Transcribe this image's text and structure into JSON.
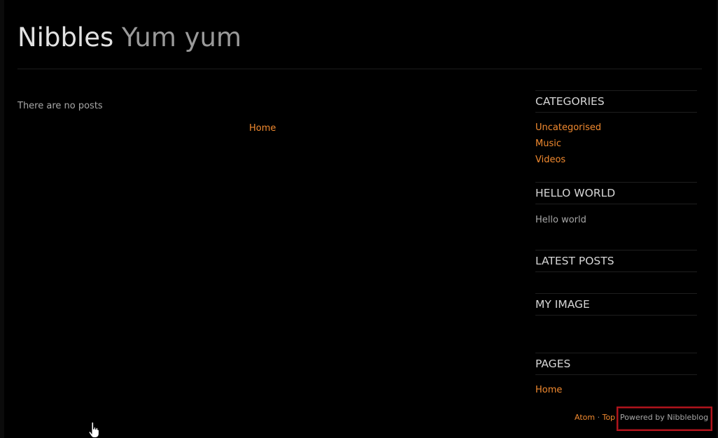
{
  "header": {
    "blog_name": "Nibbles",
    "slogan": "Yum yum"
  },
  "main": {
    "empty_message": "There are no posts",
    "pager_home_label": "Home"
  },
  "sidebar": {
    "categories": {
      "title": "CATEGORIES",
      "items": [
        "Uncategorised",
        "Music",
        "Videos"
      ]
    },
    "hello_world": {
      "title": "HELLO WORLD",
      "text": "Hello world"
    },
    "latest_posts": {
      "title": "LATEST POSTS"
    },
    "my_image": {
      "title": "MY IMAGE"
    },
    "pages": {
      "title": "PAGES",
      "items": [
        "Home"
      ]
    }
  },
  "footer": {
    "atom_label": "Atom",
    "separator": "·",
    "top_label": "Top",
    "powered_by": "Powered by Nibbleblog"
  },
  "colors": {
    "background": "#000000",
    "link": "#f28a2f",
    "title": "#e2e2e2",
    "slogan": "#9a9a9a",
    "highlight_border": "#b0141c"
  },
  "icons": {
    "cursor": "hand-pointer-icon"
  }
}
